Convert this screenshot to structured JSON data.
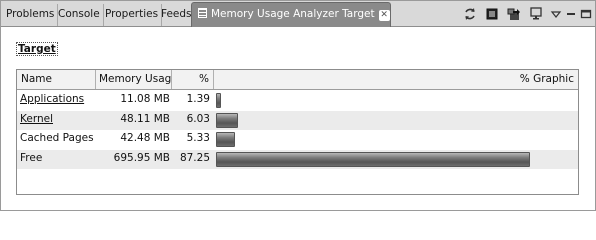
{
  "tabs": [
    {
      "label": "Problems",
      "name": "tab-problems"
    },
    {
      "label": "Console",
      "name": "tab-console"
    },
    {
      "label": "Properties",
      "name": "tab-properties"
    },
    {
      "label": "Feeds",
      "name": "tab-feeds"
    }
  ],
  "active_tab": {
    "label": "Memory Usage Analyzer Target",
    "close_icon": "close-icon",
    "view_icon": "list-view-icon"
  },
  "toolbar": {
    "icons": [
      "refresh-icon",
      "memory-chip-icon",
      "export-icon",
      "monitor-icon",
      "view-menu-icon",
      "minimize-icon",
      "maximize-icon"
    ]
  },
  "section": {
    "title": "Target"
  },
  "table": {
    "columns": [
      "Name",
      "Memory Usage",
      "%",
      "% Graphic"
    ],
    "rows": [
      {
        "name": "Applications",
        "memory": "11.08 MB",
        "percent": "1.39",
        "fraction": 0.0139
      },
      {
        "name": "Kernel",
        "memory": "48.11 MB",
        "percent": "6.03",
        "fraction": 0.0603
      },
      {
        "name": "Cached Pages",
        "memory": "42.48 MB",
        "percent": "5.33",
        "fraction": 0.0533
      },
      {
        "name": "Free",
        "memory": "695.95 MB",
        "percent": "87.25",
        "fraction": 0.8725
      }
    ]
  },
  "colors": {
    "active_tab_bg": "#8a8a8a",
    "tabbar_bg": "#d9d9d9",
    "bar_fill": "#6e6e6e",
    "alt_row_bg": "#ebebeb"
  }
}
